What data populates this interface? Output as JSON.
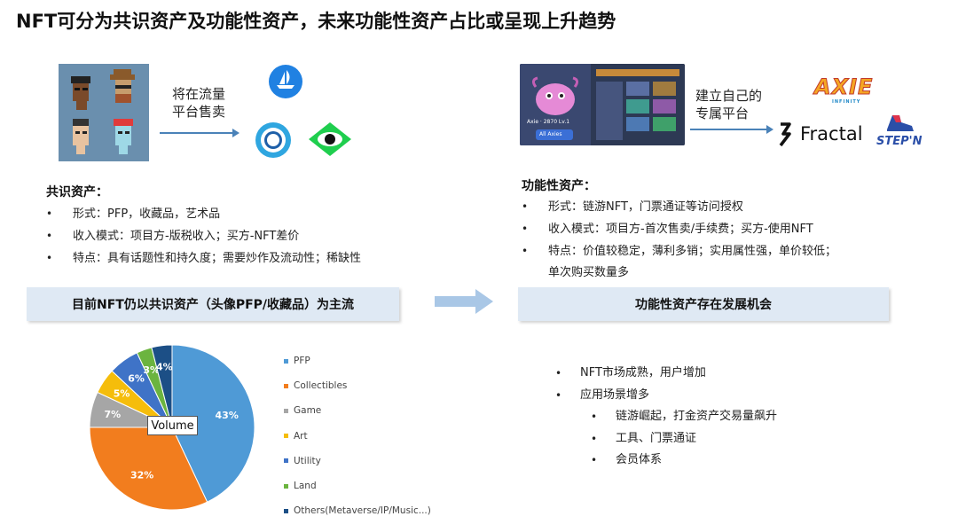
{
  "title": "NFT可分为共识资产及功能性资产，未来功能性资产占比或呈现上升趋势",
  "left": {
    "flow_label_1": "将在流量",
    "flow_label_2": "平台售卖",
    "section_heading": "共识资产：",
    "bullets": [
      "形式：PFP，收藏品，艺术品",
      "收入模式：项目方-版税收入；买方-NFT差价",
      "特点：具有话题性和持久度；需要炒作及流动性；稀缺性"
    ],
    "banner": "目前NFT仍以共识资产（头像PFP/收藏品）为主流"
  },
  "right": {
    "flow_label_1": "建立自己的",
    "flow_label_2": "专属平台",
    "brand_axie": "AXIE",
    "brand_axie_sub": "INFINITY",
    "brand_fractal": "Fractal",
    "brand_stepn": "STEP'N",
    "section_heading": "功能性资产：",
    "bullets": [
      "形式：链游NFT，门票通证等访问授权",
      "收入模式：项目方-首次售卖/手续费；买方-使用NFT",
      "特点：价值较稳定，薄利多销；实用属性强，单价较低；"
    ],
    "bullet_continuation": "单次购买数量多",
    "banner": "功能性资产存在发展机会",
    "outlook": [
      "NFT市场成熟，用户增加",
      "应用场景增多"
    ],
    "outlook_sub": [
      "链游崛起，打金资产交易量飙升",
      "工具、门票通证",
      "会员体系"
    ]
  },
  "game_ui": {
    "character_label": "Axie · 2870 Lv.1",
    "button": "All Axies"
  },
  "chart_data": {
    "type": "pie",
    "title": "",
    "center_label": "Volume",
    "categories": [
      "PFP",
      "Collectibles",
      "Game",
      "Art",
      "Utility",
      "Land",
      "Others(Metaverse/IP/Music...)"
    ],
    "values": [
      43,
      32,
      7,
      5,
      6,
      3,
      4
    ],
    "labels": [
      "43%",
      "32%",
      "7%",
      "5%",
      "6%",
      "3%",
      "4%"
    ],
    "colors": [
      "#4f9ad6",
      "#f27d1e",
      "#a6a6a6",
      "#f5bd0b",
      "#3f73c7",
      "#6bb43f",
      "#1c4f86"
    ],
    "legend_position": "right"
  }
}
